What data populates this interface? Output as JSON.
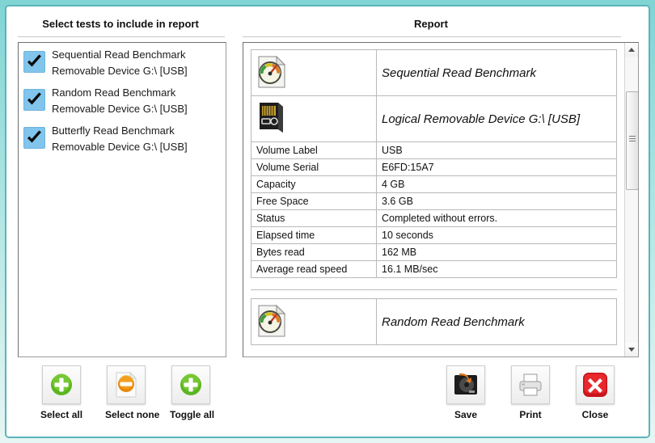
{
  "window": {
    "frame_color": "#5bb3b8",
    "background": "#ffffff"
  },
  "left_panel": {
    "title": "Select tests to include in report",
    "items": [
      {
        "checked": true,
        "name": "Sequential Read Benchmark",
        "device": "Removable Device G:\\ [USB]"
      },
      {
        "checked": true,
        "name": "Random Read Benchmark",
        "device": "Removable Device G:\\ [USB]"
      },
      {
        "checked": true,
        "name": "Butterfly Read Benchmark",
        "device": "Removable Device G:\\ [USB]"
      }
    ]
  },
  "report_panel": {
    "title": "Report",
    "blocks": [
      {
        "icon": "gauge-document-icon",
        "heading": "Sequential Read Benchmark",
        "device_icon": "memory-card-icon",
        "device_heading": "Logical Removable Device G:\\ [USB]",
        "rows": [
          {
            "key": "Volume Label",
            "value": "USB"
          },
          {
            "key": "Volume Serial",
            "value": "E6FD:15A7"
          },
          {
            "key": "Capacity",
            "value": "4 GB"
          },
          {
            "key": "Free Space",
            "value": "3.6 GB"
          },
          {
            "key": "Status",
            "value": "Completed without errors."
          },
          {
            "key": "Elapsed time",
            "value": "10 seconds"
          },
          {
            "key": "Bytes read",
            "value": "162 MB"
          },
          {
            "key": "Average read speed",
            "value": "16.1 MB/sec"
          }
        ]
      },
      {
        "icon": "gauge-document-icon",
        "heading": "Random Read Benchmark",
        "rows": []
      }
    ],
    "scrollbar": {
      "up_arrow": "scroll-up-arrow",
      "down_arrow": "scroll-down-arrow"
    }
  },
  "toolbar": {
    "left_buttons": [
      {
        "label": "Select all",
        "icon": "green-plus-icon"
      },
      {
        "label": "Select none",
        "icon": "orange-minus-document-icon"
      },
      {
        "label": "Toggle all",
        "icon": "green-plus-icon"
      }
    ],
    "right_buttons": [
      {
        "label": "Save",
        "icon": "save-disk-icon"
      },
      {
        "label": "Print",
        "icon": "printer-icon"
      },
      {
        "label": "Close",
        "icon": "red-x-icon"
      }
    ]
  }
}
